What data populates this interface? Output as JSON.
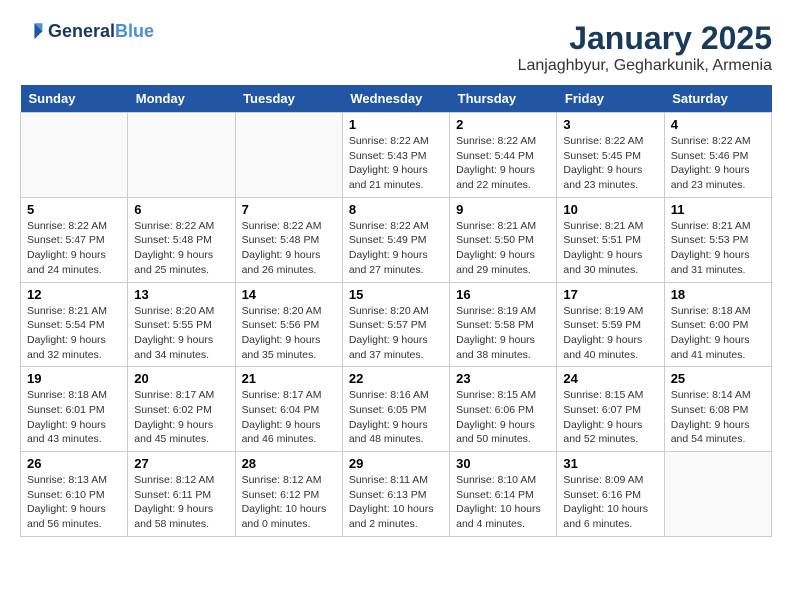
{
  "header": {
    "logo_line1": "General",
    "logo_line2": "Blue",
    "title": "January 2025",
    "subtitle": "Lanjaghbyur, Gegharkunik, Armenia"
  },
  "calendar": {
    "days_of_week": [
      "Sunday",
      "Monday",
      "Tuesday",
      "Wednesday",
      "Thursday",
      "Friday",
      "Saturday"
    ],
    "weeks": [
      [
        {
          "day": "",
          "detail": ""
        },
        {
          "day": "",
          "detail": ""
        },
        {
          "day": "",
          "detail": ""
        },
        {
          "day": "1",
          "detail": "Sunrise: 8:22 AM\nSunset: 5:43 PM\nDaylight: 9 hours\nand 21 minutes."
        },
        {
          "day": "2",
          "detail": "Sunrise: 8:22 AM\nSunset: 5:44 PM\nDaylight: 9 hours\nand 22 minutes."
        },
        {
          "day": "3",
          "detail": "Sunrise: 8:22 AM\nSunset: 5:45 PM\nDaylight: 9 hours\nand 23 minutes."
        },
        {
          "day": "4",
          "detail": "Sunrise: 8:22 AM\nSunset: 5:46 PM\nDaylight: 9 hours\nand 23 minutes."
        }
      ],
      [
        {
          "day": "5",
          "detail": "Sunrise: 8:22 AM\nSunset: 5:47 PM\nDaylight: 9 hours\nand 24 minutes."
        },
        {
          "day": "6",
          "detail": "Sunrise: 8:22 AM\nSunset: 5:48 PM\nDaylight: 9 hours\nand 25 minutes."
        },
        {
          "day": "7",
          "detail": "Sunrise: 8:22 AM\nSunset: 5:48 PM\nDaylight: 9 hours\nand 26 minutes."
        },
        {
          "day": "8",
          "detail": "Sunrise: 8:22 AM\nSunset: 5:49 PM\nDaylight: 9 hours\nand 27 minutes."
        },
        {
          "day": "9",
          "detail": "Sunrise: 8:21 AM\nSunset: 5:50 PM\nDaylight: 9 hours\nand 29 minutes."
        },
        {
          "day": "10",
          "detail": "Sunrise: 8:21 AM\nSunset: 5:51 PM\nDaylight: 9 hours\nand 30 minutes."
        },
        {
          "day": "11",
          "detail": "Sunrise: 8:21 AM\nSunset: 5:53 PM\nDaylight: 9 hours\nand 31 minutes."
        }
      ],
      [
        {
          "day": "12",
          "detail": "Sunrise: 8:21 AM\nSunset: 5:54 PM\nDaylight: 9 hours\nand 32 minutes."
        },
        {
          "day": "13",
          "detail": "Sunrise: 8:20 AM\nSunset: 5:55 PM\nDaylight: 9 hours\nand 34 minutes."
        },
        {
          "day": "14",
          "detail": "Sunrise: 8:20 AM\nSunset: 5:56 PM\nDaylight: 9 hours\nand 35 minutes."
        },
        {
          "day": "15",
          "detail": "Sunrise: 8:20 AM\nSunset: 5:57 PM\nDaylight: 9 hours\nand 37 minutes."
        },
        {
          "day": "16",
          "detail": "Sunrise: 8:19 AM\nSunset: 5:58 PM\nDaylight: 9 hours\nand 38 minutes."
        },
        {
          "day": "17",
          "detail": "Sunrise: 8:19 AM\nSunset: 5:59 PM\nDaylight: 9 hours\nand 40 minutes."
        },
        {
          "day": "18",
          "detail": "Sunrise: 8:18 AM\nSunset: 6:00 PM\nDaylight: 9 hours\nand 41 minutes."
        }
      ],
      [
        {
          "day": "19",
          "detail": "Sunrise: 8:18 AM\nSunset: 6:01 PM\nDaylight: 9 hours\nand 43 minutes."
        },
        {
          "day": "20",
          "detail": "Sunrise: 8:17 AM\nSunset: 6:02 PM\nDaylight: 9 hours\nand 45 minutes."
        },
        {
          "day": "21",
          "detail": "Sunrise: 8:17 AM\nSunset: 6:04 PM\nDaylight: 9 hours\nand 46 minutes."
        },
        {
          "day": "22",
          "detail": "Sunrise: 8:16 AM\nSunset: 6:05 PM\nDaylight: 9 hours\nand 48 minutes."
        },
        {
          "day": "23",
          "detail": "Sunrise: 8:15 AM\nSunset: 6:06 PM\nDaylight: 9 hours\nand 50 minutes."
        },
        {
          "day": "24",
          "detail": "Sunrise: 8:15 AM\nSunset: 6:07 PM\nDaylight: 9 hours\nand 52 minutes."
        },
        {
          "day": "25",
          "detail": "Sunrise: 8:14 AM\nSunset: 6:08 PM\nDaylight: 9 hours\nand 54 minutes."
        }
      ],
      [
        {
          "day": "26",
          "detail": "Sunrise: 8:13 AM\nSunset: 6:10 PM\nDaylight: 9 hours\nand 56 minutes."
        },
        {
          "day": "27",
          "detail": "Sunrise: 8:12 AM\nSunset: 6:11 PM\nDaylight: 9 hours\nand 58 minutes."
        },
        {
          "day": "28",
          "detail": "Sunrise: 8:12 AM\nSunset: 6:12 PM\nDaylight: 10 hours\nand 0 minutes."
        },
        {
          "day": "29",
          "detail": "Sunrise: 8:11 AM\nSunset: 6:13 PM\nDaylight: 10 hours\nand 2 minutes."
        },
        {
          "day": "30",
          "detail": "Sunrise: 8:10 AM\nSunset: 6:14 PM\nDaylight: 10 hours\nand 4 minutes."
        },
        {
          "day": "31",
          "detail": "Sunrise: 8:09 AM\nSunset: 6:16 PM\nDaylight: 10 hours\nand 6 minutes."
        },
        {
          "day": "",
          "detail": ""
        }
      ]
    ]
  }
}
